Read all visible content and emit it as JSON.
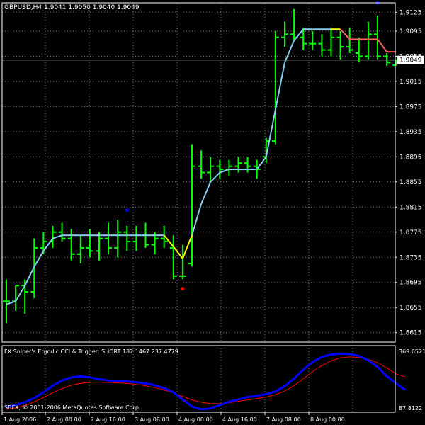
{
  "window": {
    "header": "GBPUSD,H4  1.9041 1.9050 1.9040 1.9049",
    "symbol": "GBPUSD",
    "timeframe": "H4",
    "ohlc": [
      "1.9041",
      "1.9050",
      "1.9040",
      "1.9049"
    ]
  },
  "price_axis": {
    "ticks": [
      "1.9125",
      "1.9095",
      "1.9055",
      "1.9015",
      "1.8975",
      "1.8935",
      "1.8895",
      "1.8855",
      "1.8815",
      "1.8775",
      "1.8735",
      "1.8695",
      "1.8655",
      "1.8615"
    ],
    "current_price": "1.9049"
  },
  "time_axis": {
    "labels": [
      "1 Aug 2006",
      "2 Aug 00:00",
      "2 Aug 16:00",
      "3 Aug 08:00",
      "4 Aug 00:00",
      "4 Aug 16:00",
      "7 Aug 08:00",
      "8 Aug 00:00"
    ]
  },
  "indicator": {
    "title": "FX Sniper's Ergodic CCI & Trigger: SHORT 182.1467 237.4779",
    "scale_top": "369.6521",
    "scale_bottom": "87.8122",
    "copyright": "SBFX, © 2001-2006 MetaQuotes Software Corp."
  },
  "colors": {
    "background": "#000000",
    "grid": "#808080",
    "bar": "#00ff00",
    "ma_up": "#87ceeb",
    "ma_mid": "#ffff00",
    "ma_down": "#ff6060",
    "cci": "#0000ff",
    "trigger": "#ff0000",
    "arrow_up": "#0000ff",
    "arrow_down": "#ff0000"
  },
  "chart_data": {
    "type": "line",
    "price_range": [
      1.86,
      1.914
    ],
    "bars": [
      {
        "o": 1.8665,
        "h": 1.87,
        "l": 1.863,
        "c": 1.8665
      },
      {
        "o": 1.8665,
        "h": 1.869,
        "l": 1.865,
        "c": 1.869
      },
      {
        "o": 1.869,
        "h": 1.87,
        "l": 1.8645,
        "c": 1.868
      },
      {
        "o": 1.868,
        "h": 1.8765,
        "l": 1.867,
        "c": 1.875
      },
      {
        "o": 1.875,
        "h": 1.8775,
        "l": 1.874,
        "c": 1.876
      },
      {
        "o": 1.876,
        "h": 1.8785,
        "l": 1.875,
        "c": 1.8775
      },
      {
        "o": 1.8775,
        "h": 1.879,
        "l": 1.876,
        "c": 1.8765
      },
      {
        "o": 1.8765,
        "h": 1.878,
        "l": 1.873,
        "c": 1.874
      },
      {
        "o": 1.874,
        "h": 1.877,
        "l": 1.8725,
        "c": 1.875
      },
      {
        "o": 1.875,
        "h": 1.878,
        "l": 1.8735,
        "c": 1.8745
      },
      {
        "o": 1.8745,
        "h": 1.8775,
        "l": 1.873,
        "c": 1.8765
      },
      {
        "o": 1.8765,
        "h": 1.879,
        "l": 1.874,
        "c": 1.875
      },
      {
        "o": 1.875,
        "h": 1.8795,
        "l": 1.8735,
        "c": 1.8775
      },
      {
        "o": 1.8775,
        "h": 1.8785,
        "l": 1.8745,
        "c": 1.876
      },
      {
        "o": 1.876,
        "h": 1.8785,
        "l": 1.8745,
        "c": 1.877
      },
      {
        "o": 1.877,
        "h": 1.879,
        "l": 1.875,
        "c": 1.8755
      },
      {
        "o": 1.8755,
        "h": 1.8775,
        "l": 1.874,
        "c": 1.8765
      },
      {
        "o": 1.8765,
        "h": 1.8785,
        "l": 1.875,
        "c": 1.876
      },
      {
        "o": 1.875,
        "h": 1.877,
        "l": 1.87,
        "c": 1.8705
      },
      {
        "o": 1.8705,
        "h": 1.8755,
        "l": 1.87,
        "c": 1.8705
      },
      {
        "o": 1.8725,
        "h": 1.8915,
        "l": 1.872,
        "c": 1.888
      },
      {
        "o": 1.888,
        "h": 1.8905,
        "l": 1.886,
        "c": 1.887
      },
      {
        "o": 1.887,
        "h": 1.8895,
        "l": 1.8855,
        "c": 1.888
      },
      {
        "o": 1.888,
        "h": 1.889,
        "l": 1.886,
        "c": 1.8875
      },
      {
        "o": 1.8875,
        "h": 1.889,
        "l": 1.8865,
        "c": 1.888
      },
      {
        "o": 1.888,
        "h": 1.8895,
        "l": 1.887,
        "c": 1.8885
      },
      {
        "o": 1.8885,
        "h": 1.8895,
        "l": 1.887,
        "c": 1.888
      },
      {
        "o": 1.888,
        "h": 1.889,
        "l": 1.886,
        "c": 1.8875
      },
      {
        "o": 1.8895,
        "h": 1.8925,
        "l": 1.8885,
        "c": 1.892
      },
      {
        "o": 1.892,
        "h": 1.9095,
        "l": 1.8915,
        "c": 1.9085
      },
      {
        "o": 1.9085,
        "h": 1.911,
        "l": 1.907,
        "c": 1.909
      },
      {
        "o": 1.909,
        "h": 1.913,
        "l": 1.908,
        "c": 1.9085
      },
      {
        "o": 1.9085,
        "h": 1.91,
        "l": 1.9065,
        "c": 1.9075
      },
      {
        "o": 1.9075,
        "h": 1.9095,
        "l": 1.9065,
        "c": 1.9075
      },
      {
        "o": 1.9075,
        "h": 1.909,
        "l": 1.9055,
        "c": 1.9065
      },
      {
        "o": 1.9065,
        "h": 1.91,
        "l": 1.9055,
        "c": 1.9085
      },
      {
        "o": 1.9085,
        "h": 1.9095,
        "l": 1.905,
        "c": 1.907
      },
      {
        "o": 1.907,
        "h": 1.91,
        "l": 1.906,
        "c": 1.9065
      },
      {
        "o": 1.906,
        "h": 1.9085,
        "l": 1.9045,
        "c": 1.9055
      },
      {
        "o": 1.9055,
        "h": 1.911,
        "l": 1.905,
        "c": 1.909
      },
      {
        "o": 1.909,
        "h": 1.912,
        "l": 1.905,
        "c": 1.9055
      },
      {
        "o": 1.9055,
        "h": 1.906,
        "l": 1.904,
        "c": 1.9045
      },
      {
        "o": 1.9041,
        "h": 1.905,
        "l": 1.904,
        "c": 1.9049
      }
    ],
    "ma": [
      1.866,
      1.8665,
      1.869,
      1.872,
      1.8745,
      1.8765,
      1.877,
      1.877,
      1.877,
      1.877,
      1.877,
      1.877,
      1.877,
      1.877,
      1.877,
      1.877,
      1.877,
      1.877,
      1.8752,
      1.8733,
      1.877,
      1.882,
      1.8855,
      1.887,
      1.8875,
      1.8875,
      1.8875,
      1.8875,
      1.8895,
      1.897,
      1.9045,
      1.908,
      1.9098,
      1.9098,
      1.9098,
      1.9098,
      1.9098,
      1.9082,
      1.9082,
      1.9082,
      1.9082,
      1.9062,
      1.9062
    ],
    "ma_color_index": [
      0,
      0,
      0,
      0,
      0,
      0,
      0,
      0,
      0,
      0,
      0,
      0,
      0,
      0,
      0,
      0,
      0,
      0,
      1,
      1,
      1,
      0,
      0,
      0,
      0,
      0,
      0,
      0,
      0,
      0,
      0,
      0,
      0,
      0,
      0,
      0,
      1,
      2,
      2,
      2,
      2,
      2,
      2
    ],
    "arrows": [
      {
        "bar": 13,
        "price": 1.881,
        "dir": "up"
      },
      {
        "bar": 19,
        "price": 1.8685,
        "dir": "down"
      },
      {
        "bar": 40,
        "price": 1.914,
        "dir": "up"
      }
    ],
    "indicator_range": [
      87.8122,
      369.6521
    ],
    "cci": [
      110,
      118,
      130,
      148,
      172,
      200,
      222,
      235,
      240,
      235,
      228,
      222,
      220,
      218,
      215,
      210,
      202,
      190,
      172,
      142,
      112,
      100,
      104,
      118,
      132,
      142,
      152,
      158,
      164,
      176,
      198,
      230,
      268,
      300,
      322,
      332,
      336,
      334,
      326,
      308,
      280,
      240,
      210,
      182
    ],
    "trigger": [
      100,
      106,
      116,
      132,
      150,
      170,
      188,
      202,
      210,
      214,
      215,
      214,
      212,
      210,
      206,
      200,
      192,
      182,
      170,
      155,
      140,
      130,
      124,
      124,
      128,
      134,
      140,
      146,
      152,
      162,
      178,
      200,
      230,
      260,
      286,
      305,
      318,
      322,
      320,
      312,
      298,
      275,
      250,
      237
    ]
  }
}
